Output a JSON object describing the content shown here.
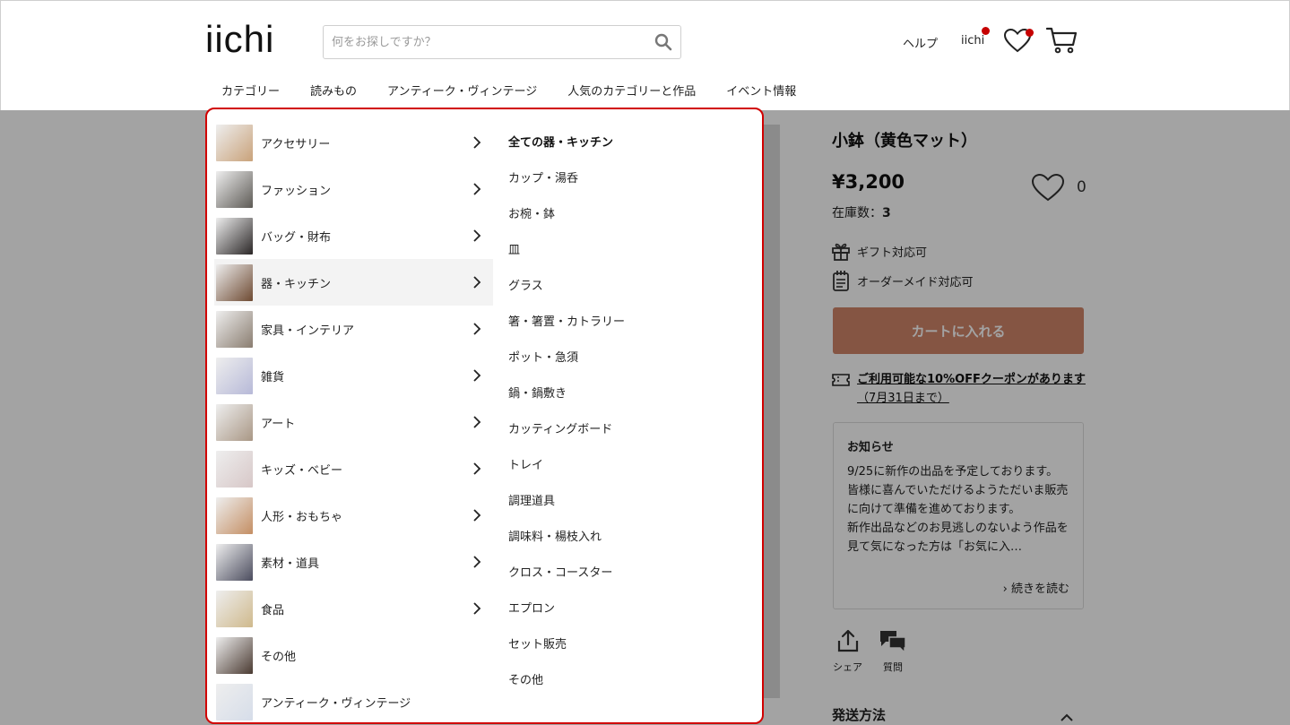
{
  "header": {
    "logo": "iichi",
    "search_placeholder": "何をお探しですか？",
    "help": "ヘルプ",
    "user": "iichi",
    "nav": [
      "カテゴリー",
      "読みもの",
      "アンティーク・ヴィンテージ",
      "人気のカテゴリーと作品",
      "イベント情報"
    ]
  },
  "menu": {
    "categories": [
      {
        "label": "アクセサリー",
        "thumb": "#c9a27a",
        "has_sub": true
      },
      {
        "label": "ファッション",
        "thumb": "#5d5a55",
        "has_sub": true
      },
      {
        "label": "バッグ・財布",
        "thumb": "#2a2626",
        "has_sub": true
      },
      {
        "label": "器・キッチン",
        "thumb": "#6e4a32",
        "has_sub": true
      },
      {
        "label": "家具・インテリア",
        "thumb": "#8a7d70",
        "has_sub": true
      },
      {
        "label": "雑貨",
        "thumb": "#b7b9d8",
        "has_sub": true
      },
      {
        "label": "アート",
        "thumb": "#a99785",
        "has_sub": true
      },
      {
        "label": "キッズ・ベビー",
        "thumb": "#d7c7c7",
        "has_sub": true
      },
      {
        "label": "人形・おもちゃ",
        "thumb": "#c48e63",
        "has_sub": true
      },
      {
        "label": "素材・道具",
        "thumb": "#4b4c5e",
        "has_sub": true
      },
      {
        "label": "食品",
        "thumb": "#cfb98c",
        "has_sub": true
      },
      {
        "label": "その他",
        "thumb": "#4a3a31",
        "has_sub": false
      },
      {
        "label": "アンティーク・ヴィンテージ",
        "thumb": "#d6dde9",
        "has_sub": false
      }
    ],
    "active_index": 3,
    "subcategories": [
      "全ての器・キッチン",
      "カップ・湯呑",
      "お椀・鉢",
      "皿",
      "グラス",
      "箸・箸置・カトラリー",
      "ポット・急須",
      "鍋・鍋敷き",
      "カッティングボード",
      "トレイ",
      "調理道具",
      "調味料・楊枝入れ",
      "クロス・コースター",
      "エプロン",
      "セット販売",
      "その他"
    ]
  },
  "product": {
    "title": "小鉢（黄色マット）",
    "price": "¥3,200",
    "stock_label": "在庫数：",
    "stock_value": "3",
    "fav_count": "0",
    "gift": "ギフト対応可",
    "order": "オーダーメイド対応可",
    "cart_button": "カートに入れる",
    "coupon_main": "ご利用可能な10%OFFクーポンがあります",
    "coupon_date": "（7月31日まで）",
    "notice_title": "お知らせ",
    "notice_body": "9/25に新作の出品を予定しております。\n皆様に喜んでいただけるようただいま販売に向けて準備を進めております。\n新作出品などのお見逃しのないよう作品を見て気になった方は「お気に入…",
    "notice_more": "› 続きを読む",
    "share": "シェア",
    "ask": "質問",
    "shipping": "発送方法"
  },
  "colors": {
    "accent_red": "#d10000",
    "cart_button": "#d1856a",
    "badge": "#c60000"
  }
}
